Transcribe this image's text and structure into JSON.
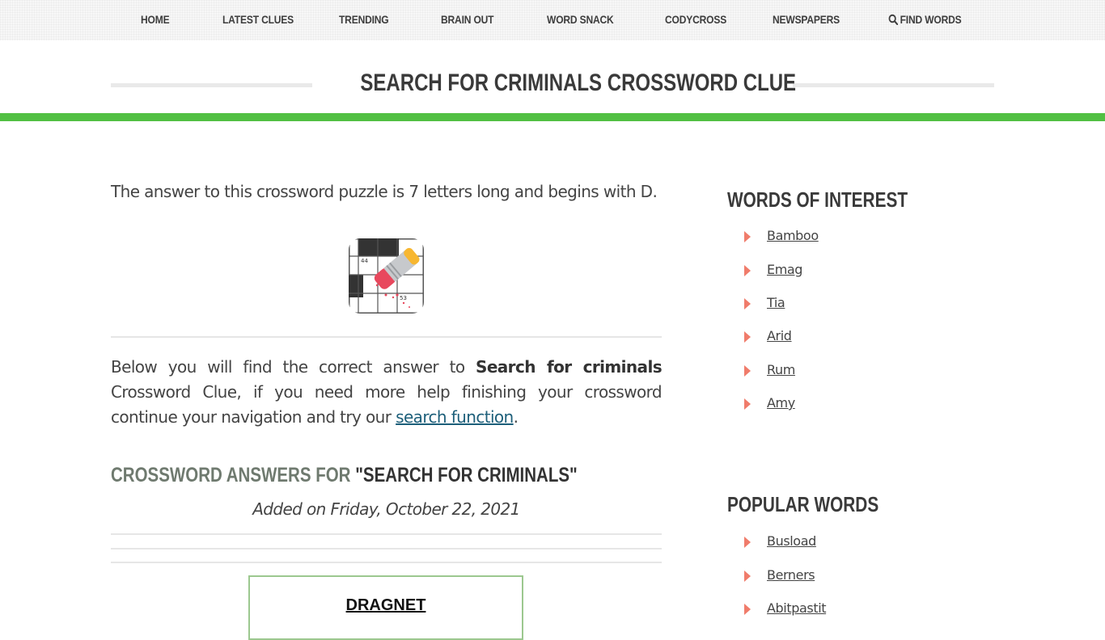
{
  "nav": {
    "items": [
      {
        "label": "HOME"
      },
      {
        "label": "LATEST CLUES"
      },
      {
        "label": "TRENDING"
      },
      {
        "label": "BRAIN OUT"
      },
      {
        "label": "WORD SNACK"
      },
      {
        "label": "CODYCROSS"
      },
      {
        "label": "NEWSPAPERS"
      },
      {
        "label": "FIND WORDS",
        "icon": "search-icon"
      }
    ]
  },
  "header": {
    "title": "SEARCH FOR CRIMINALS CROSSWORD CLUE",
    "accent_color": "#52c043"
  },
  "main": {
    "intro": "The answer to this crossword puzzle is 7 letters long and begins with D.",
    "logo_icon": "crossword-eraser-icon",
    "desc_pre": "Below you will find the correct answer to ",
    "desc_bold": "Search for criminals",
    "desc_mid": " Crossword Clue, if you need more help finishing your crossword continue your navigation and try our ",
    "desc_link": "search function",
    "desc_post": ".",
    "answers_heading_prefix": "CROSSWORD ANSWERS FOR ",
    "answers_heading_query": "\"SEARCH FOR CRIMINALS\"",
    "added_on": "Added on Friday, October 22, 2021",
    "answer": "DRAGNET"
  },
  "sidebar": {
    "words_of_interest": {
      "title": "WORDS OF INTEREST",
      "items": [
        "Bamboo",
        "Emag",
        "Tia",
        "Arid",
        "Rum",
        "Amy"
      ]
    },
    "popular_words": {
      "title": "POPULAR WORDS",
      "items": [
        "Busload",
        "Berners",
        "Abitpastit"
      ]
    },
    "bullet_color": "#f07c6b"
  }
}
